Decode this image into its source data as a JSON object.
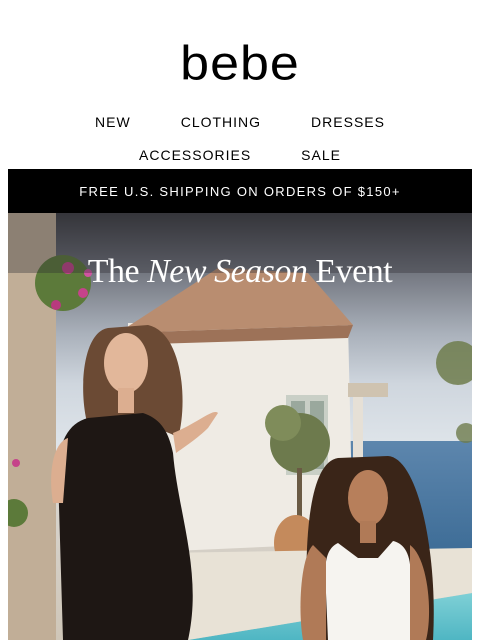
{
  "brand": {
    "logo": "bebe"
  },
  "nav": {
    "row1": [
      "NEW",
      "CLOTHING",
      "DRESSES"
    ],
    "row2": [
      "ACCESSORIES",
      "SALE"
    ]
  },
  "promo": {
    "text": "FREE U.S. SHIPPING ON ORDERS OF $150+"
  },
  "hero": {
    "title_part1": "The ",
    "title_italic": "New Season",
    "title_part2": " Event",
    "image": "two-women-in-dresses-mediterranean-villa"
  },
  "colors": {
    "promo_bg": "#000000",
    "promo_text": "#ffffff",
    "page_bg": "#ffffff"
  }
}
